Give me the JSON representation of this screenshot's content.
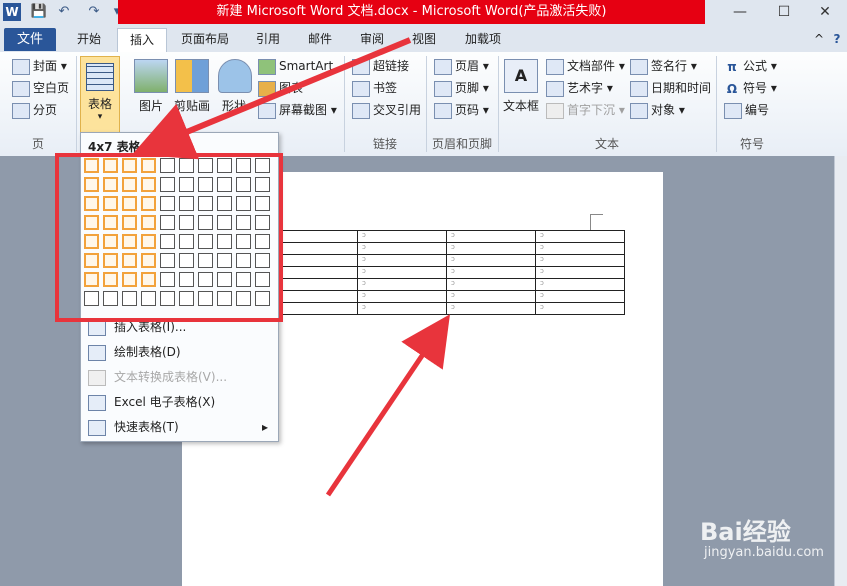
{
  "window": {
    "title": "新建 Microsoft Word 文档.docx  -  Microsoft Word(产品激活失败)",
    "controls": {
      "minimize": "—",
      "maximize": "☐",
      "close": "✕"
    },
    "app_icon": "W"
  },
  "quick_access": {
    "save": "💾",
    "undo": "↶",
    "redo": "↷",
    "more": "▾"
  },
  "tabs": {
    "file": "文件",
    "items": [
      "开始",
      "插入",
      "页面布局",
      "引用",
      "邮件",
      "审阅",
      "视图",
      "加载项"
    ],
    "active": "插入",
    "help": "?",
    "collapse": "^"
  },
  "ribbon": {
    "pages_group": {
      "label": "页",
      "items": [
        "封面 ▾",
        "空白页",
        "分页"
      ]
    },
    "table_group": {
      "label": "表格",
      "button": "表格"
    },
    "illustrations": {
      "picture": "图片",
      "clipart": "剪贴画",
      "shapes": "形状",
      "smartart": "SmartArt",
      "chart": "图表",
      "screenshot": "屏幕截图 ▾"
    },
    "links_group": {
      "label": "链接",
      "items": [
        "超链接",
        "书签",
        "交叉引用"
      ]
    },
    "header_footer_group": {
      "label": "页眉和页脚",
      "items": [
        "页眉 ▾",
        "页脚 ▾",
        "页码 ▾"
      ]
    },
    "text_group": {
      "label": "文本",
      "textbox": "文本框",
      "items_col1": [
        "文档部件 ▾",
        "艺术字 ▾",
        "首字下沉 ▾"
      ],
      "items_col2": [
        "签名行 ▾",
        "日期和时间",
        "对象 ▾"
      ]
    },
    "symbols_group": {
      "label": "符号",
      "items": [
        "公式 ▾",
        "符号 ▾",
        "编号"
      ]
    }
  },
  "table_dropdown": {
    "grid_label": "4x7 表格",
    "grid_rows": 8,
    "grid_cols": 10,
    "selected_cols": 4,
    "selected_rows": 7,
    "menu": [
      {
        "label": "插入表格(I)...",
        "disabled": false
      },
      {
        "label": "绘制表格(D)",
        "disabled": false
      },
      {
        "label": "文本转换成表格(V)...",
        "disabled": true
      },
      {
        "label": "Excel 电子表格(X)",
        "disabled": false
      },
      {
        "label": "快速表格(T)",
        "disabled": false,
        "submenu": "▸"
      }
    ]
  },
  "document": {
    "table_rows": 7,
    "table_cols": 4,
    "cell_mark": "ↄ"
  },
  "watermark": {
    "brand": "Bai经验",
    "url": "jingyan.baidu.com"
  },
  "colors": {
    "annotation_red": "#e8343c",
    "selection_orange": "#f2a23c",
    "file_tab": "#2a5699"
  }
}
